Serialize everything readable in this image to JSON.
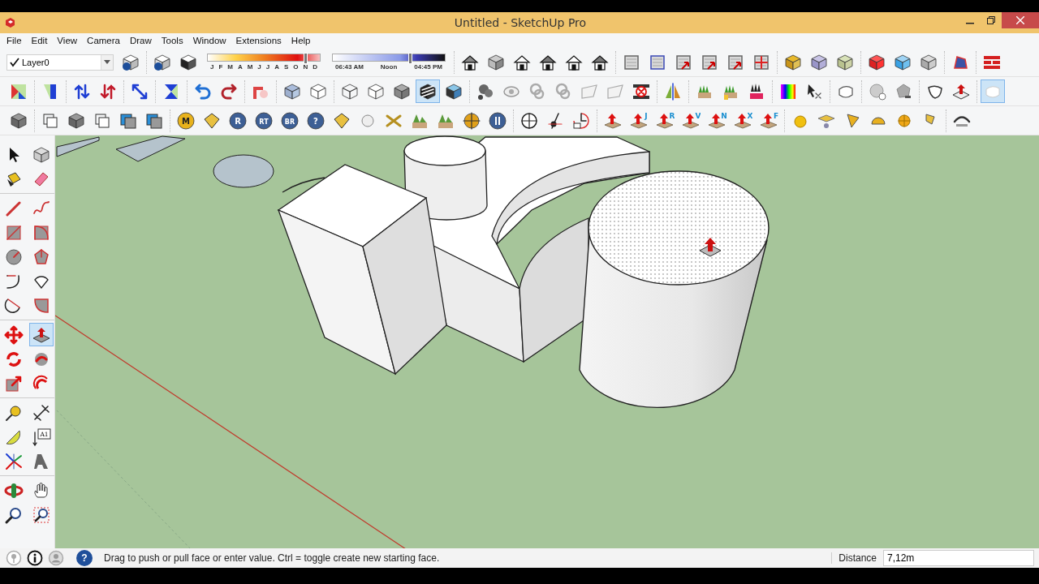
{
  "window": {
    "title": "Untitled - SketchUp Pro"
  },
  "menu": [
    "File",
    "Edit",
    "View",
    "Camera",
    "Draw",
    "Tools",
    "Window",
    "Extensions",
    "Help"
  ],
  "layer_bar": {
    "checked": true,
    "name": "Layer0",
    "items": [
      {
        "kind": "layer-manager",
        "selected": false
      }
    ]
  },
  "shadow_bar": {
    "items": [
      {
        "kind": "shadow-settings",
        "selected": false
      },
      {
        "kind": "shadow-toggle",
        "selected": false
      }
    ],
    "months": [
      "J",
      "F",
      "M",
      "A",
      "M",
      "J",
      "J",
      "A",
      "S",
      "O",
      "N",
      "D"
    ],
    "month_slider": {
      "level": 0.87
    },
    "times": [
      "06:43 AM",
      "Noon",
      "04:45 PM"
    ],
    "time_slider": {
      "level": 0.69
    }
  },
  "toolbars": [
    [
      [
        {
          "kind": "house-iso",
          "selected": false
        },
        {
          "kind": "box-front",
          "selected": false
        },
        {
          "kind": "house",
          "selected": false
        },
        {
          "kind": "house-roof",
          "selected": false
        },
        {
          "kind": "house",
          "selected": false
        },
        {
          "kind": "house-roof",
          "selected": false
        }
      ],
      [
        {
          "kind": "texture",
          "selected": false
        },
        {
          "kind": "texture-frame",
          "selected": false
        },
        {
          "kind": "texture-arrow",
          "selected": false
        },
        {
          "kind": "texture-arrow",
          "selected": false
        },
        {
          "kind": "texture-arrow",
          "selected": false
        },
        {
          "kind": "texture-expand",
          "selected": false
        }
      ],
      [
        {
          "kind": "gem",
          "selected": false
        },
        {
          "kind": "gem-faceted",
          "selected": false
        },
        {
          "kind": "gem-rounded",
          "selected": false
        }
      ],
      [
        {
          "kind": "solid-cube",
          "selected": false
        },
        {
          "kind": "glass-cube",
          "selected": false
        },
        {
          "kind": "plain-cube",
          "selected": false
        }
      ],
      [
        {
          "kind": "face",
          "selected": false
        }
      ],
      [
        {
          "kind": "bricks",
          "selected": false
        }
      ]
    ],
    [
      [
        {
          "kind": "map",
          "selected": false
        }
      ],
      [
        {
          "kind": "half-panel",
          "selected": false
        }
      ],
      [
        {
          "kind": "arrows-swap",
          "selected": false
        },
        {
          "kind": "arrows-flip",
          "selected": false
        }
      ],
      [
        {
          "kind": "arrow-diagonal",
          "selected": false
        }
      ],
      [
        {
          "kind": "hourglass",
          "selected": false
        }
      ],
      [
        {
          "kind": "undo",
          "selected": false
        },
        {
          "kind": "redo",
          "selected": false
        }
      ],
      [
        {
          "kind": "corner-arrow",
          "selected": false
        }
      ],
      [
        {
          "kind": "xray-cube",
          "selected": false
        },
        {
          "kind": "wire-cube",
          "selected": false
        }
      ],
      [
        {
          "kind": "wireframe",
          "selected": false
        },
        {
          "kind": "hidden-line",
          "selected": false
        },
        {
          "kind": "shaded",
          "selected": false
        },
        {
          "kind": "textured",
          "selected": true
        },
        {
          "kind": "monochrome",
          "selected": false
        }
      ],
      [
        {
          "kind": "film",
          "selected": false
        },
        {
          "kind": "eye",
          "selected": false
        },
        {
          "kind": "reel",
          "selected": false
        },
        {
          "kind": "reel",
          "selected": false
        },
        {
          "kind": "plane",
          "selected": false
        },
        {
          "kind": "plane",
          "selected": false
        },
        {
          "kind": "section-x",
          "selected": false
        }
      ],
      [
        {
          "kind": "mirror",
          "selected": false
        }
      ],
      [
        {
          "kind": "plants-tag",
          "selected": false
        },
        {
          "kind": "plants-box",
          "selected": false
        },
        {
          "kind": "plants-silhouette",
          "selected": false
        }
      ],
      [
        {
          "kind": "color-grid",
          "selected": false
        },
        {
          "kind": "cursor-axes",
          "selected": false
        }
      ],
      [
        {
          "kind": "soft-cube",
          "selected": false
        }
      ],
      [
        {
          "kind": "sphere-plus",
          "selected": false
        },
        {
          "kind": "rock-minus",
          "selected": false
        }
      ],
      [
        {
          "kind": "bowl",
          "selected": false
        },
        {
          "kind": "push-face",
          "selected": false
        }
      ],
      [
        {
          "kind": "rounded-cube",
          "selected": true
        }
      ]
    ],
    [
      [
        {
          "kind": "stacked-cubes",
          "selected": false
        }
      ],
      [
        {
          "kind": "wire-stack",
          "selected": false
        },
        {
          "kind": "stacked-squares",
          "selected": false
        },
        {
          "kind": "wire-stack",
          "selected": false
        },
        {
          "kind": "layered-squares",
          "selected": false
        },
        {
          "kind": "layered-squares",
          "selected": false
        }
      ],
      [
        {
          "kind": "coin",
          "label": "M",
          "selected": false
        },
        {
          "kind": "tag",
          "selected": false
        },
        {
          "kind": "round-badge",
          "label": "R",
          "selected": false
        },
        {
          "kind": "round-badge",
          "label": "RT",
          "selected": false
        },
        {
          "kind": "round-badge",
          "label": "BR",
          "selected": false
        },
        {
          "kind": "round-badge",
          "label": "?",
          "selected": false
        },
        {
          "kind": "tag",
          "selected": false
        },
        {
          "kind": "sphere",
          "selected": false
        },
        {
          "kind": "cross",
          "selected": false
        },
        {
          "kind": "landscape",
          "selected": false
        },
        {
          "kind": "landscape",
          "selected": false
        },
        {
          "kind": "target",
          "selected": false
        },
        {
          "kind": "pause",
          "selected": false
        }
      ],
      [
        {
          "kind": "crosshair",
          "selected": false
        },
        {
          "kind": "slash",
          "selected": false
        },
        {
          "kind": "clock",
          "selected": false
        }
      ],
      [
        {
          "kind": "arrow-box",
          "selected": false
        },
        {
          "kind": "arrow-box",
          "label": "J",
          "selected": false
        },
        {
          "kind": "arrow-box",
          "label": "R",
          "selected": false
        },
        {
          "kind": "arrow-box",
          "label": "V",
          "selected": false
        },
        {
          "kind": "arrow-box",
          "label": "N",
          "selected": false
        },
        {
          "kind": "arrow-box",
          "label": "X",
          "selected": false
        },
        {
          "kind": "arrow-box",
          "label": "F",
          "selected": false
        }
      ],
      [
        {
          "kind": "ball",
          "selected": false
        },
        {
          "kind": "diamond-pin",
          "selected": false
        },
        {
          "kind": "flag",
          "selected": false
        },
        {
          "kind": "half-ball",
          "selected": false
        },
        {
          "kind": "ball-grid",
          "selected": false
        },
        {
          "kind": "tag-small",
          "selected": false
        }
      ],
      [
        {
          "kind": "bend",
          "selected": false
        }
      ]
    ]
  ],
  "tool_palette": [
    [
      {
        "kind": "select",
        "selected": false
      },
      {
        "kind": "component",
        "selected": false
      },
      {
        "kind": "paint",
        "selected": false
      },
      {
        "kind": "eraser",
        "selected": false
      }
    ],
    [
      {
        "kind": "pencil",
        "selected": false
      },
      {
        "kind": "freehand",
        "selected": false
      },
      {
        "kind": "rectangle",
        "selected": false
      },
      {
        "kind": "rotated-rectangle",
        "selected": false
      },
      {
        "kind": "circle",
        "selected": false
      },
      {
        "kind": "polygon",
        "selected": false
      },
      {
        "kind": "arc",
        "selected": false
      },
      {
        "kind": "arc-pie",
        "selected": false
      },
      {
        "kind": "arc-three",
        "selected": false
      },
      {
        "kind": "arc-corner",
        "selected": false
      }
    ],
    [
      {
        "kind": "move",
        "selected": false
      },
      {
        "kind": "push-pull",
        "selected": true
      },
      {
        "kind": "rotate",
        "selected": false
      },
      {
        "kind": "follow-me",
        "selected": false
      },
      {
        "kind": "scale",
        "selected": false
      },
      {
        "kind": "offset",
        "selected": false
      }
    ],
    [
      {
        "kind": "tape",
        "selected": false
      },
      {
        "kind": "dimension",
        "selected": false
      },
      {
        "kind": "protractor",
        "selected": false
      },
      {
        "kind": "text-label",
        "label": "A1",
        "selected": false
      },
      {
        "kind": "axes",
        "selected": false
      },
      {
        "kind": "text-3d",
        "selected": false
      }
    ],
    [
      {
        "kind": "orbit",
        "selected": false
      },
      {
        "kind": "pan",
        "selected": false
      },
      {
        "kind": "zoom",
        "selected": false
      },
      {
        "kind": "zoom-window",
        "selected": false
      }
    ]
  ],
  "status_bar": {
    "help_label": "?",
    "message": "Drag to push or pull face or enter value.  Ctrl = toggle create new starting face.",
    "measure_label": "Distance",
    "measure_value": "7,12m"
  }
}
